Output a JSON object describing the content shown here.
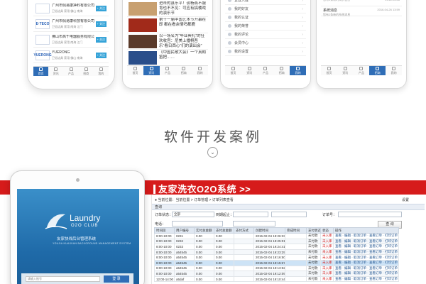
{
  "section_title": "软件开发案例",
  "phone1": {
    "items": [
      {
        "logo": "",
        "name": "广州市佩易康净料有限公司",
        "sub": "卫浴洁具  家用  佛山  南海",
        "btn": "+ 关注"
      },
      {
        "logo": "E·TECO",
        "name": "广州市佩易康科技有限公司",
        "sub": "卫浴洁具  家用  南海  江门",
        "btn": "+ 关注"
      },
      {
        "logo": "",
        "name": "佛山市高千电器服务有限公司",
        "sub": "卫浴洁具  家用  南海  江门",
        "btn": "+ 关注"
      },
      {
        "logo": "YUERONG",
        "name": "YUERONG",
        "sub": "卫浴洁具  家用  佛山  南海",
        "btn": "+ 关注"
      }
    ],
    "tabs": [
      "首页",
      "资讯",
      "产品",
      "招商",
      "我的"
    ]
  },
  "phone2": {
    "news": [
      {
        "title": "进击的县乐平！谈杨燕不服肯也不不见：可应有搞楼戏的演乐节"
      },
      {
        "title": "第十一届中国艺术节开幕在即 都在看余情吗都鹿"
      },
      {
        "title": "以一场名为“毕业典礼”的狂欢收官：尼美上播桐吾乐“看日西心“们的演出会”"
      },
      {
        "title": "《中国民歌大会》一个真朗笛把……"
      }
    ],
    "tabs": [
      "首页",
      "资讯",
      "产品",
      "招商",
      "我的"
    ]
  },
  "phone3": {
    "menu": [
      "企业入驻",
      "我的好友",
      "我的认证",
      "我的荣誉",
      "我的评论",
      "会员中心",
      "我的设置"
    ],
    "tabs": [
      "首页",
      "资讯",
      "产品",
      "招商",
      "我的"
    ]
  },
  "phone4": {
    "messages": [
      {
        "title": "",
        "sub": "您有1条新的询价信息",
        "time": "2016-04-28"
      },
      {
        "title": "系统消息",
        "sub": "您有2条新的系统消息",
        "time": "2016-04-26 13:59"
      }
    ],
    "tabs": [
      "首页",
      "资讯",
      "产品",
      "招商",
      "我的"
    ]
  },
  "banner": {
    "title": "友家洗衣O2O系统 >>"
  },
  "tablet": {
    "brand": "Laundry",
    "club": "O2O CLUB",
    "system": "友家快线后台管理系统",
    "system_en": "YOUJIA KUAIXIAN BACKGROUND MANAGEMENT SYSTEM",
    "login_placeholder": "请输入账号",
    "login_button": "登 录"
  },
  "admin": {
    "breadcrumb": "● 当前位置：当前位置 > 订单管理 > 订单列表查看",
    "breadcrumb_right": "设置",
    "query_label": "查询",
    "filters": {
      "status_label": "订单状态：",
      "status_value": "全部",
      "time_label": "到期起止：",
      "order_label": "订单号：",
      "phone_label": "电话："
    },
    "search_button": "查 询",
    "columns": [
      "时间段",
      "用户编号",
      "实付总金额",
      "支付总金额",
      "支付方式",
      "创建时间",
      "完成时间",
      "支付状态",
      "状态",
      "操作"
    ],
    "rows": [
      {
        "t": "8:00-10:00",
        "id": "0231",
        "a": "0.00",
        "b": "0.00",
        "pay": "",
        "created": "2015-02-04 19:26:33",
        "done": "",
        "ps": "未付款",
        "s": "未入库",
        "op": "查看 · 编辑 · 取消订单 · 查看订单 · 打印订单"
      },
      {
        "t": "8:00-10:00",
        "id": "0232",
        "a": "0.00",
        "b": "0.00",
        "pay": "",
        "created": "2015-02-04 19:25:01",
        "done": "",
        "ps": "未付款",
        "s": "未入库",
        "op": "查看 · 编辑 · 取消订单 · 查看订单 · 打印订单"
      },
      {
        "t": "8:00-10:00",
        "id": "0233",
        "a": "0.00",
        "b": "0.00",
        "pay": "",
        "created": "2015-02-04 19:24:41",
        "done": "",
        "ps": "未付款",
        "s": "未入库",
        "op": "查看 · 编辑 · 取消订单 · 查看订单 · 打印订单"
      },
      {
        "t": "8:00-10:00",
        "id": "a54545",
        "a": "0.00",
        "b": "0.00",
        "pay": "",
        "created": "2015-02-04 19:23:29",
        "done": "",
        "ps": "未付款",
        "s": "未入库",
        "op": "查看 · 编辑 · 取消订单 · 查看订单 · 打印订单"
      },
      {
        "t": "8:00-10:00",
        "id": "a54545",
        "a": "0.00",
        "b": "0.00",
        "pay": "",
        "created": "2015-02-04 19:16:50",
        "done": "",
        "ps": "未付款",
        "s": "未入库",
        "op": "查看 · 编辑 · 取消订单 · 查看订单 · 打印订单"
      },
      {
        "t": "8:00-10:00",
        "id": "a54545",
        "a": "0.00",
        "b": "0.00",
        "pay": "",
        "created": "2015-02-04 19:15:27",
        "done": "",
        "ps": "未付款",
        "s": "未入库",
        "op": "查看 · 编辑 · 取消订单 · 查看订单 · 打印订单"
      },
      {
        "t": "8:00-10:00",
        "id": "a54545",
        "a": "0.00",
        "b": "0.00",
        "pay": "",
        "created": "2015-02-04 19:13:52",
        "done": "",
        "ps": "未付款",
        "s": "未入库",
        "op": "查看 · 编辑 · 取消订单 · 查看订单 · 打印订单"
      },
      {
        "t": "8:00-10:00",
        "id": "a54545",
        "a": "0.00",
        "b": "0.00",
        "pay": "",
        "created": "2015-02-04 19:12:09",
        "done": "",
        "ps": "未付款",
        "s": "未入库",
        "op": "查看 · 编辑 · 取消订单 · 查看订单 · 打印订单"
      },
      {
        "t": "12:00-14:00",
        "id": "a5daf",
        "a": "0.00",
        "b": "0.00",
        "pay": "",
        "created": "2015-02-04 19:10:44",
        "done": "",
        "ps": "未付款",
        "s": "未入库",
        "op": "查看 · 编辑 · 取消订单 · 查看订单 · 打印订单"
      }
    ]
  },
  "colors": {
    "brand_red": "#d61b1b",
    "brand_blue": "#2f6db6",
    "tablet_blue": "#1f6aa8"
  }
}
